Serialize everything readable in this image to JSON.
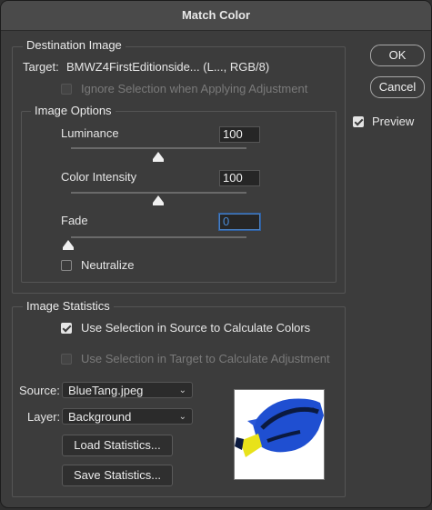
{
  "window": {
    "title": "Match Color"
  },
  "destination": {
    "legend": "Destination Image",
    "target_label": "Target:",
    "target_value": "BMWZ4FirstEditionside... (L..., RGB/8)",
    "ignore_selection": {
      "label": "Ignore Selection when Applying Adjustment",
      "checked": false,
      "enabled": false
    }
  },
  "image_options": {
    "legend": "Image Options",
    "luminance": {
      "label": "Luminance",
      "value": "100",
      "slider": 0.5
    },
    "color_intensity": {
      "label": "Color Intensity",
      "value": "100",
      "slider": 0.5
    },
    "fade": {
      "label": "Fade",
      "value": "0",
      "slider": 0.0
    },
    "neutralize": {
      "label": "Neutralize",
      "checked": false
    }
  },
  "statistics": {
    "legend": "Image Statistics",
    "use_source": {
      "label": "Use Selection in Source to Calculate Colors",
      "checked": true
    },
    "use_target": {
      "label": "Use Selection in Target to Calculate Adjustment",
      "checked": false,
      "enabled": false
    },
    "source_label": "Source:",
    "source_value": "BlueTang.jpeg",
    "layer_label": "Layer:",
    "layer_value": "Background",
    "load_label": "Load Statistics...",
    "save_label": "Save Statistics..."
  },
  "buttons": {
    "ok": "OK",
    "cancel": "Cancel"
  },
  "preview": {
    "label": "Preview",
    "checked": true
  },
  "icons": {
    "dropdown": "chevron-down-icon",
    "slider": "slider-thumb-icon"
  },
  "colors": {
    "accent": "#4a8ad4",
    "fish_blue": "#1f4fd1",
    "fish_yellow": "#e8e21a"
  }
}
